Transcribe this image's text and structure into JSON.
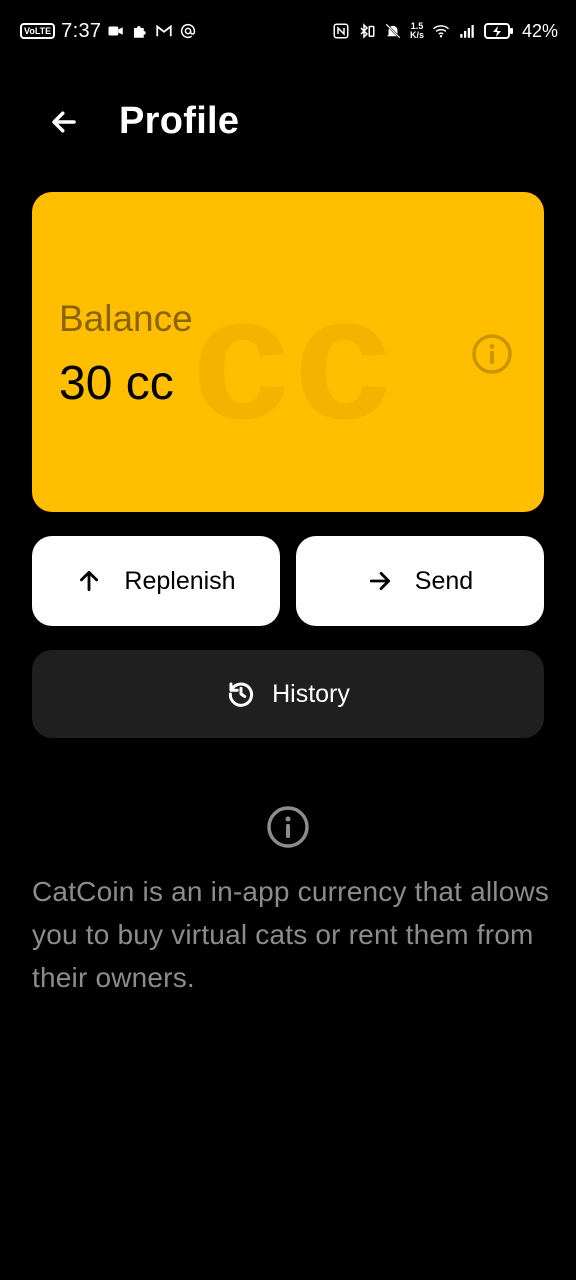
{
  "status_bar": {
    "volte": "VoLTE",
    "time": "7:37",
    "net_speed_value": "1.5",
    "net_speed_unit": "K/s",
    "battery_percent": "42%"
  },
  "header": {
    "title": "Profile"
  },
  "balance_card": {
    "label": "Balance",
    "value": "30 cc",
    "watermark": "cc",
    "color": "#FFBF00"
  },
  "actions": {
    "replenish_label": "Replenish",
    "send_label": "Send",
    "history_label": "History"
  },
  "info": {
    "text": "CatCoin is an in-app currency that allows you to buy virtual cats or rent them from their owners."
  }
}
